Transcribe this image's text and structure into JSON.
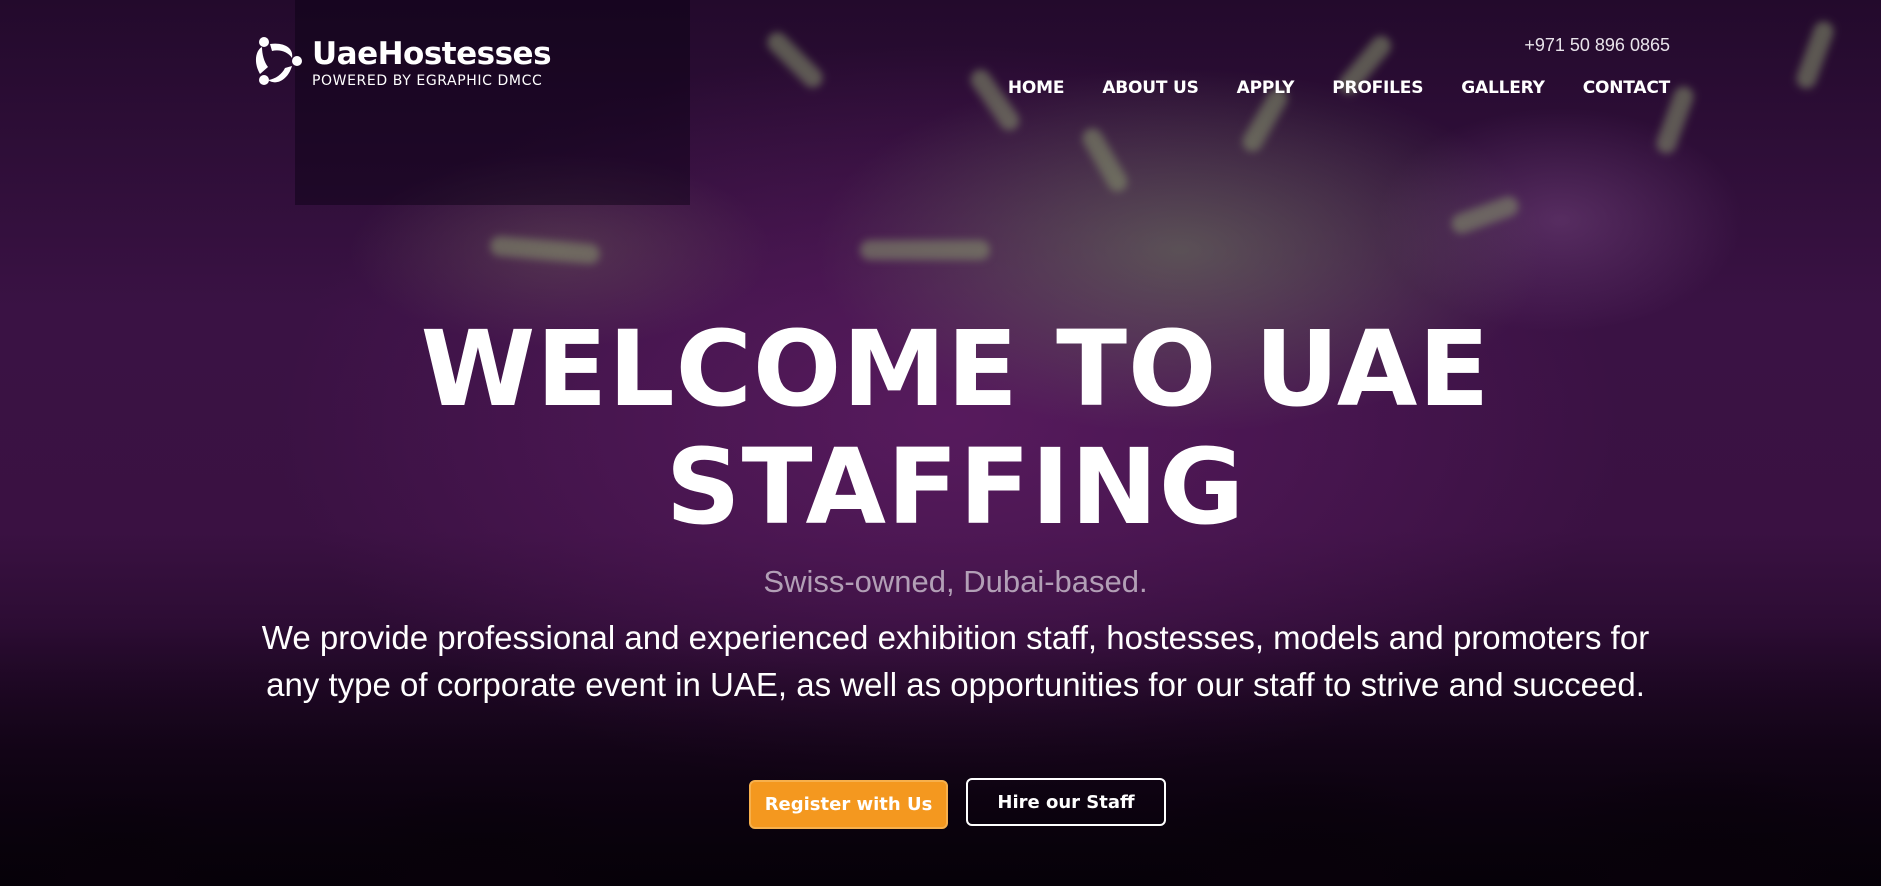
{
  "brand": {
    "name": "UaeHostesses",
    "tagline": "POWERED BY EGRAPHIC DMCC",
    "logo_icon": "three-figures-circle-icon"
  },
  "header": {
    "phone": "+971 50 896 0865",
    "nav": [
      {
        "label": "HOME"
      },
      {
        "label": "ABOUT US"
      },
      {
        "label": "APPLY"
      },
      {
        "label": "PROFILES"
      },
      {
        "label": "GALLERY"
      },
      {
        "label": "CONTACT"
      }
    ]
  },
  "hero": {
    "title_line1": "WELCOME TO UAE",
    "title_line2": "STAFFING",
    "subtitle": "Swiss-owned, Dubai-based.",
    "description": "We provide professional and experienced exhibition staff, hostesses, models and promoters for any type of corporate event in UAE, as well as opportunities for our staff to strive and succeed.",
    "primary_cta": "Register with Us",
    "secondary_cta": "Hire our Staff"
  },
  "colors": {
    "accent": "#f4981f",
    "background": "#3a1244",
    "text": "#ffffff",
    "subtitle": "#b29fb6"
  }
}
